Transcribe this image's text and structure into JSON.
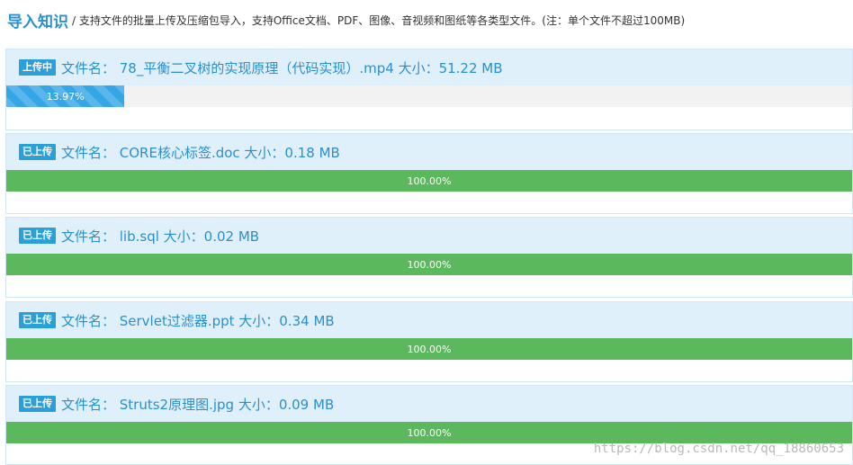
{
  "header": {
    "title": "导入知识",
    "description": "/ 支持文件的批量上传及压缩包导入，支持Office文档、PDF、图像、音视频和图纸等各类型文件。(注：单个文件不超过100MB)"
  },
  "uploads": [
    {
      "badge": "上传中",
      "label": "文件名： 78_平衡二叉树的实现原理（代码实现）.mp4 大小：51.22 MB",
      "progress_text": "13.97%",
      "progress": 13.97,
      "state": "uploading"
    },
    {
      "badge": "已上传",
      "label": "文件名： CORE核心标签.doc 大小：0.18 MB",
      "progress_text": "100.00%",
      "progress": 100,
      "state": "done"
    },
    {
      "badge": "已上传",
      "label": "文件名： lib.sql 大小：0.02 MB",
      "progress_text": "100.00%",
      "progress": 100,
      "state": "done"
    },
    {
      "badge": "已上传",
      "label": "文件名： Servlet过滤器.ppt 大小：0.34 MB",
      "progress_text": "100.00%",
      "progress": 100,
      "state": "done"
    },
    {
      "badge": "已上传",
      "label": "文件名： Struts2原理图.jpg 大小：0.09 MB",
      "progress_text": "100.00%",
      "progress": 100,
      "state": "done"
    }
  ],
  "watermark": "https://blog.csdn.net/qq_18860653",
  "colors": {
    "accent": "#2a8fd0",
    "badge": "#2b9fd8",
    "done": "#5cb85c",
    "uploading": "#36a7e6",
    "head_bg": "#dff0fa"
  }
}
